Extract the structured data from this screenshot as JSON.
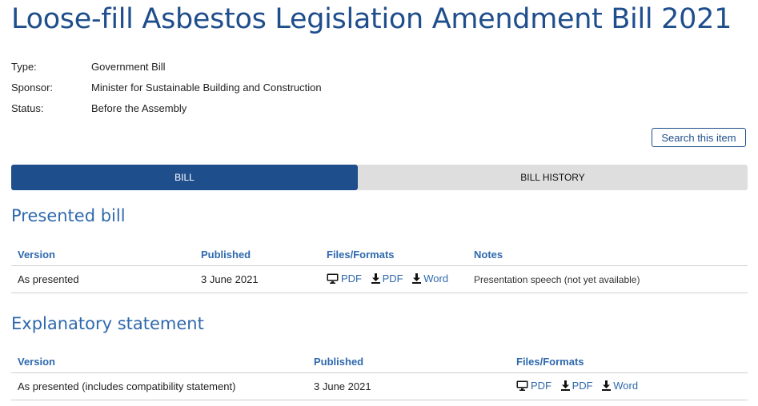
{
  "page_title": "Loose-fill Asbestos Legislation Amendment Bill 2021",
  "meta": [
    {
      "label": "Type:",
      "value": "Government Bill"
    },
    {
      "label": "Sponsor:",
      "value": "Minister for Sustainable Building and Construction"
    },
    {
      "label": "Status:",
      "value": "Before the Assembly"
    }
  ],
  "search_button": "Search this item",
  "tabs": [
    {
      "label": "BILL",
      "active": true
    },
    {
      "label": "BILL HISTORY",
      "active": false
    }
  ],
  "presented_bill": {
    "title": "Presented bill",
    "headers": [
      "Version",
      "Published",
      "Files/Formats",
      "Notes"
    ],
    "rows": [
      {
        "version": "As presented",
        "published": "3 June 2021",
        "files": [
          {
            "icon": "monitor-icon",
            "label": "PDF"
          },
          {
            "icon": "download-icon",
            "label": "PDF"
          },
          {
            "icon": "download-icon",
            "label": "Word"
          }
        ],
        "notes": "Presentation speech (not yet available)"
      }
    ]
  },
  "explanatory_statement": {
    "title": "Explanatory statement",
    "headers": [
      "Version",
      "Published",
      "Files/Formats"
    ],
    "rows": [
      {
        "version": "As presented (includes compatibility statement)",
        "published": "3 June 2021",
        "files": [
          {
            "icon": "monitor-icon",
            "label": "PDF"
          },
          {
            "icon": "download-icon",
            "label": "PDF"
          },
          {
            "icon": "download-icon",
            "label": "Word"
          }
        ]
      }
    ]
  },
  "colors": {
    "title": "#1f4e8c",
    "accent": "#2f69ad",
    "active_tab": "#1f4e8c",
    "inactive_tab": "#dedede"
  }
}
